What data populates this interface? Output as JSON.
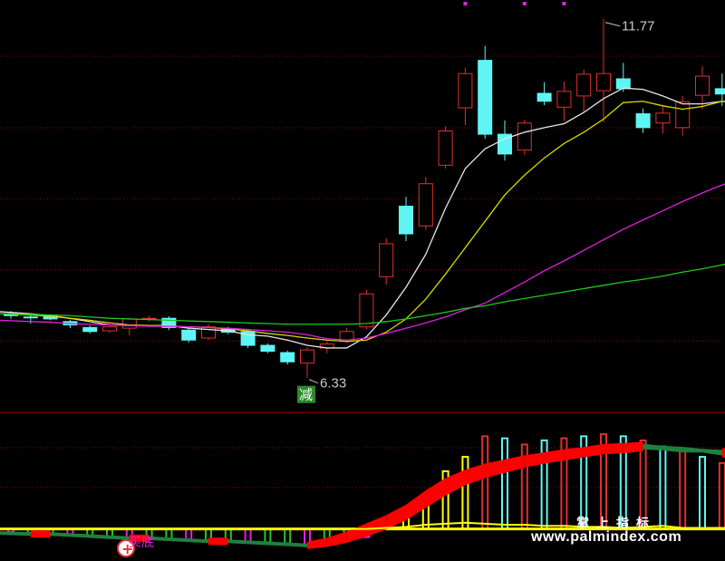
{
  "chart_data": [
    {
      "type": "candlestick",
      "annotations": {
        "high_label": "11.77",
        "low_label": "6.33",
        "signal_label": "减"
      },
      "colors": {
        "up": "#e03030",
        "down": "#5ff5f5",
        "ma5": "#e6e6e6",
        "ma10": "#d8d800",
        "ma20": "#e020e0",
        "ma60": "#20c820",
        "grid": "#a00000"
      },
      "ylim": [
        5.9,
        12.0
      ],
      "candles": [
        {
          "o": 7.3,
          "h": 7.34,
          "l": 7.22,
          "c": 7.27
        },
        {
          "o": 7.25,
          "h": 7.28,
          "l": 7.15,
          "c": 7.24
        },
        {
          "o": 7.26,
          "h": 7.29,
          "l": 7.2,
          "c": 7.22
        },
        {
          "o": 7.18,
          "h": 7.21,
          "l": 7.08,
          "c": 7.13
        },
        {
          "o": 7.09,
          "h": 7.12,
          "l": 7.0,
          "c": 7.03
        },
        {
          "o": 7.04,
          "h": 7.14,
          "l": 7.01,
          "c": 7.1
        },
        {
          "o": 7.08,
          "h": 7.24,
          "l": 6.97,
          "c": 7.22
        },
        {
          "o": 7.22,
          "h": 7.27,
          "l": 7.18,
          "c": 7.23
        },
        {
          "o": 7.23,
          "h": 7.26,
          "l": 7.05,
          "c": 7.09
        },
        {
          "o": 7.05,
          "h": 7.08,
          "l": 6.86,
          "c": 6.9
        },
        {
          "o": 6.93,
          "h": 7.14,
          "l": 6.9,
          "c": 7.1
        },
        {
          "o": 7.07,
          "h": 7.1,
          "l": 6.99,
          "c": 7.02
        },
        {
          "o": 7.03,
          "h": 7.06,
          "l": 6.78,
          "c": 6.82
        },
        {
          "o": 6.82,
          "h": 6.85,
          "l": 6.7,
          "c": 6.73
        },
        {
          "o": 6.71,
          "h": 6.74,
          "l": 6.53,
          "c": 6.57
        },
        {
          "o": 6.55,
          "h": 6.79,
          "l": 6.33,
          "c": 6.75
        },
        {
          "o": 6.78,
          "h": 6.88,
          "l": 6.7,
          "c": 6.84
        },
        {
          "o": 6.88,
          "h": 7.08,
          "l": 6.86,
          "c": 7.03
        },
        {
          "o": 7.1,
          "h": 7.66,
          "l": 7.06,
          "c": 7.6
        },
        {
          "o": 7.86,
          "h": 8.44,
          "l": 7.74,
          "c": 8.36
        },
        {
          "o": 8.93,
          "h": 9.07,
          "l": 8.4,
          "c": 8.51
        },
        {
          "o": 8.63,
          "h": 9.37,
          "l": 8.57,
          "c": 9.27
        },
        {
          "o": 9.55,
          "h": 10.14,
          "l": 9.5,
          "c": 10.07
        },
        {
          "o": 10.42,
          "h": 11.03,
          "l": 10.16,
          "c": 10.94
        },
        {
          "o": 11.14,
          "h": 11.36,
          "l": 9.95,
          "c": 10.02
        },
        {
          "o": 10.02,
          "h": 10.23,
          "l": 9.62,
          "c": 9.72
        },
        {
          "o": 9.78,
          "h": 10.24,
          "l": 9.71,
          "c": 10.19
        },
        {
          "o": 10.64,
          "h": 10.81,
          "l": 10.46,
          "c": 10.52
        },
        {
          "o": 10.43,
          "h": 10.82,
          "l": 10.22,
          "c": 10.67
        },
        {
          "o": 10.6,
          "h": 11.0,
          "l": 10.35,
          "c": 10.93
        },
        {
          "o": 10.68,
          "h": 11.77,
          "l": 10.2,
          "c": 10.94
        },
        {
          "o": 10.86,
          "h": 11.1,
          "l": 10.66,
          "c": 10.71
        },
        {
          "o": 10.33,
          "h": 10.41,
          "l": 10.04,
          "c": 10.12
        },
        {
          "o": 10.19,
          "h": 10.44,
          "l": 10.03,
          "c": 10.34
        },
        {
          "o": 10.12,
          "h": 10.6,
          "l": 10.0,
          "c": 10.51
        },
        {
          "o": 10.61,
          "h": 11.05,
          "l": 10.4,
          "c": 10.9
        },
        {
          "o": 10.71,
          "h": 10.94,
          "l": 10.45,
          "c": 10.63
        },
        {
          "o": 10.65,
          "h": 10.7,
          "l": 10.33,
          "c": 10.44
        }
      ],
      "series": [
        {
          "values": [
            7.33,
            7.3,
            7.27,
            7.23,
            7.18,
            7.13,
            7.12,
            7.12,
            7.12,
            7.08,
            7.06,
            7.04,
            6.98,
            6.96,
            6.9,
            6.82,
            6.78,
            6.78,
            6.95,
            7.28,
            7.7,
            8.2,
            8.9,
            9.5,
            9.8,
            9.95,
            10.05,
            10.12,
            10.18,
            10.35,
            10.56,
            10.72,
            10.7,
            10.6,
            10.48,
            10.48,
            10.52,
            10.48
          ]
        },
        {
          "values": [
            7.3,
            7.28,
            7.26,
            7.23,
            7.2,
            7.16,
            7.13,
            7.12,
            7.11,
            7.1,
            7.09,
            7.07,
            7.04,
            7.0,
            6.97,
            6.93,
            6.9,
            6.88,
            6.9,
            7.02,
            7.22,
            7.52,
            7.9,
            8.3,
            8.7,
            9.1,
            9.4,
            9.66,
            9.88,
            10.05,
            10.25,
            10.5,
            10.52,
            10.45,
            10.4,
            10.44,
            10.52,
            10.52
          ]
        },
        {
          "values": [
            7.2,
            7.18,
            7.17,
            7.15,
            7.14,
            7.13,
            7.12,
            7.11,
            7.11,
            7.1,
            7.09,
            7.08,
            7.06,
            7.04,
            7.02,
            6.98,
            6.92,
            6.9,
            6.93,
            7.0,
            7.08,
            7.16,
            7.25,
            7.36,
            7.46,
            7.62,
            7.78,
            7.95,
            8.1,
            8.26,
            8.42,
            8.58,
            8.72,
            8.86,
            9.0,
            9.13,
            9.25,
            9.36
          ]
        },
        {
          "values": [
            7.3,
            7.29,
            7.28,
            7.27,
            7.25,
            7.23,
            7.22,
            7.21,
            7.2,
            7.19,
            7.18,
            7.17,
            7.16,
            7.15,
            7.14,
            7.14,
            7.14,
            7.14,
            7.15,
            7.18,
            7.22,
            7.27,
            7.32,
            7.38,
            7.42,
            7.48,
            7.53,
            7.58,
            7.63,
            7.68,
            7.73,
            7.78,
            7.82,
            7.87,
            7.93,
            7.98,
            8.04,
            8.1
          ]
        }
      ]
    },
    {
      "type": "indicator",
      "labels": [
        "买",
        "底"
      ],
      "ylim": [
        -25,
        100
      ],
      "bars": [
        -3,
        -4,
        -5,
        -6,
        -7,
        -8,
        -8,
        -9,
        -10,
        -10,
        -11,
        -12,
        -13,
        -13,
        -14,
        -15,
        -16,
        -12,
        -8,
        6,
        16,
        30,
        56,
        70,
        90,
        88,
        82,
        86,
        88,
        90,
        92,
        90,
        86,
        80,
        76,
        70,
        64,
        58
      ],
      "band_upper": [
        -4,
        -5,
        -5,
        -6,
        -7,
        -8,
        -9,
        -9,
        -10,
        -11,
        -12,
        -12,
        -13,
        -14,
        -15,
        -16,
        -12,
        -6,
        2,
        10,
        20,
        34,
        46,
        54,
        60,
        64,
        68,
        71,
        74,
        76,
        79,
        80,
        81,
        79,
        78,
        76,
        75,
        75
      ],
      "band_lower": [
        -4,
        -5,
        -5,
        -6,
        -7,
        -8,
        -9,
        -9,
        -10,
        -11,
        -12,
        -12,
        -13,
        -14,
        -15,
        -16,
        -14,
        -10,
        -4,
        3,
        12,
        24,
        36,
        46,
        53,
        58,
        63,
        67,
        70,
        73,
        76,
        77,
        79,
        78,
        76,
        76,
        73,
        72
      ],
      "yellow_line": [
        0,
        0,
        0,
        0,
        0,
        0,
        0,
        0,
        0,
        0,
        0,
        0,
        0,
        0,
        0,
        0,
        0,
        0,
        0,
        1,
        2,
        4,
        5,
        6,
        5,
        4,
        4,
        3,
        3,
        2,
        2,
        1,
        2,
        3,
        1,
        1,
        1,
        0
      ],
      "colors": {
        "pos_up": "#e03030",
        "pos_down": "#5ff5f5",
        "neg": "#20c820",
        "neg2": "#e020e0",
        "band_up": "#ff0000",
        "band_down": "#208040",
        "line": "#ffff00",
        "baseline": "#ffff00"
      }
    }
  ],
  "watermark": {
    "cn": "掌上指标",
    "url": "www.palmindex.com"
  }
}
